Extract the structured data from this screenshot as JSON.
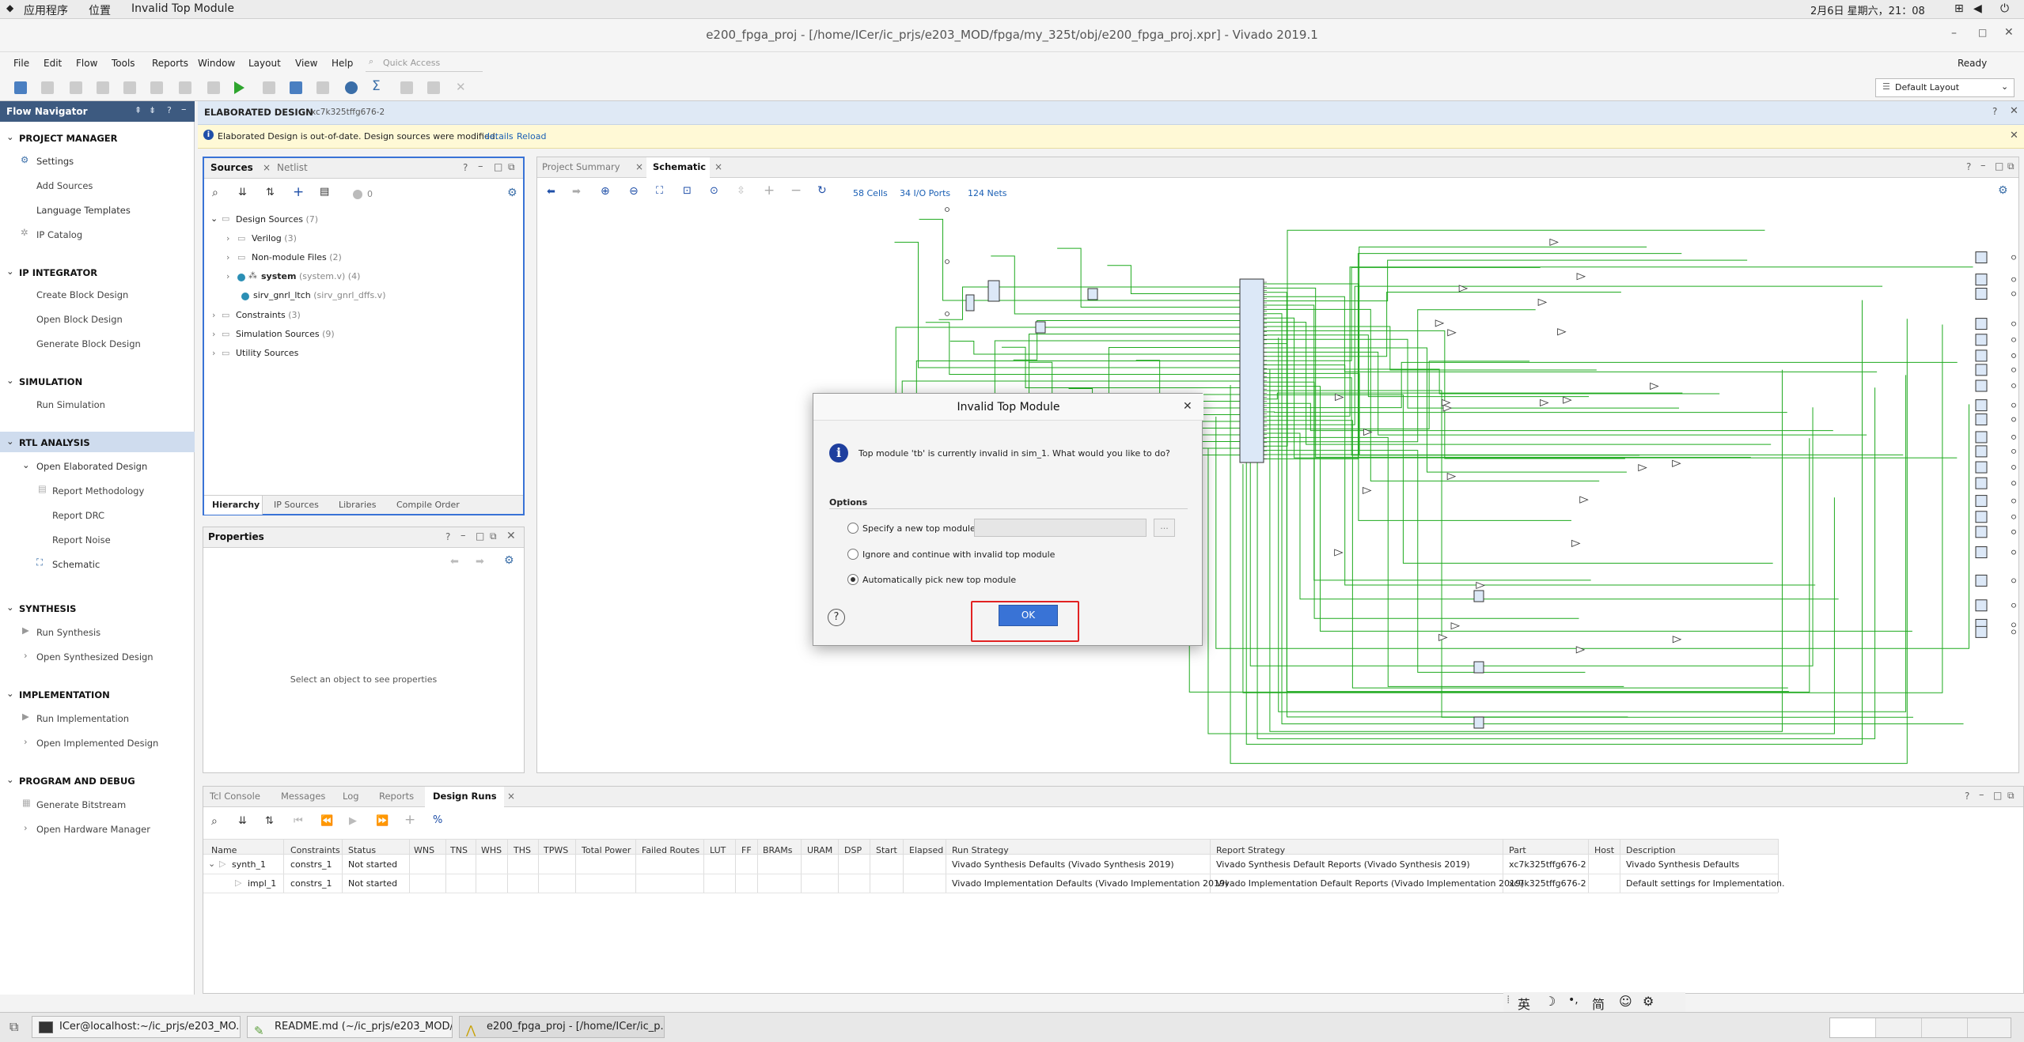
{
  "system_bar": {
    "apps": "应用程序",
    "places": "位置",
    "active_window": "Invalid Top Module",
    "clock": "2月6日 星期六，21：08"
  },
  "window": {
    "title": "e200_fpga_proj - [/home/ICer/ic_prjs/e203_MOD/fpga/my_325t/obj/e200_fpga_proj.xpr] - Vivado 2019.1",
    "status": "Ready"
  },
  "menu": [
    "File",
    "Edit",
    "Flow",
    "Tools",
    "Reports",
    "Window",
    "Layout",
    "View",
    "Help"
  ],
  "quick_access": {
    "placeholder": "Quick Access"
  },
  "layout_select": "Default Layout",
  "flow_navigator": {
    "title": "Flow Navigator",
    "sections": [
      {
        "label": "PROJECT MANAGER",
        "items": [
          "Settings",
          "Add Sources",
          "Language Templates",
          "IP Catalog"
        ]
      },
      {
        "label": "IP INTEGRATOR",
        "items": [
          "Create Block Design",
          "Open Block Design",
          "Generate Block Design"
        ]
      },
      {
        "label": "SIMULATION",
        "items": [
          "Run Simulation"
        ]
      },
      {
        "label": "RTL ANALYSIS",
        "items": [
          "Open Elaborated Design",
          "Report Methodology",
          "Report DRC",
          "Report Noise",
          "Schematic"
        ]
      },
      {
        "label": "SYNTHESIS",
        "items": [
          "Run Synthesis",
          "Open Synthesized Design"
        ]
      },
      {
        "label": "IMPLEMENTATION",
        "items": [
          "Run Implementation",
          "Open Implemented Design"
        ]
      },
      {
        "label": "PROGRAM AND DEBUG",
        "items": [
          "Generate Bitstream",
          "Open Hardware Manager"
        ]
      }
    ]
  },
  "elaborated": {
    "title": "ELABORATED DESIGN",
    "part": "xc7k325tffg676-2"
  },
  "warning": {
    "text": "Elaborated Design is out-of-date. Design sources were modified.",
    "details": "details",
    "reload": "Reload"
  },
  "sources": {
    "tabs": [
      "Sources",
      "Netlist"
    ],
    "count": "0",
    "tree": [
      {
        "label": "Design Sources",
        "extra": "(7)"
      },
      {
        "label": "Verilog",
        "extra": "(3)"
      },
      {
        "label": "Non-module Files",
        "extra": "(2)"
      },
      {
        "label": "system",
        "extra": "(system.v) (4)"
      },
      {
        "label": "sirv_gnrl_ltch",
        "extra": "(sirv_gnrl_dffs.v)"
      },
      {
        "label": "Constraints",
        "extra": "(3)"
      },
      {
        "label": "Simulation Sources",
        "extra": "(9)"
      },
      {
        "label": "Utility Sources",
        "extra": ""
      }
    ],
    "bottom_tabs": [
      "Hierarchy",
      "IP Sources",
      "Libraries",
      "Compile Order"
    ]
  },
  "properties": {
    "title": "Properties",
    "empty": "Select an object to see properties"
  },
  "schematic": {
    "tabs": [
      "Project Summary",
      "Schematic"
    ],
    "cells": "58 Cells",
    "ports": "34 I/O Ports",
    "nets": "124 Nets"
  },
  "dialog": {
    "title": "Invalid Top Module",
    "message": "Top module 'tb' is currently invalid in sim_1. What would you like to do?",
    "options_label": "Options",
    "option1": "Specify a new top module:",
    "option1_value": "",
    "option2": "Ignore and continue with invalid top module",
    "option3": "Automatically pick new top module",
    "selected": 3,
    "browse": "...",
    "ok": "OK"
  },
  "bottom_panel": {
    "tabs": [
      "Tcl Console",
      "Messages",
      "Log",
      "Reports",
      "Design Runs"
    ],
    "columns": [
      "Name",
      "Constraints",
      "Status",
      "WNS",
      "TNS",
      "WHS",
      "THS",
      "TPWS",
      "Total Power",
      "Failed Routes",
      "LUT",
      "FF",
      "BRAMs",
      "URAM",
      "DSP",
      "Start",
      "Elapsed",
      "Run Strategy",
      "Report Strategy",
      "Part",
      "Host",
      "Description"
    ],
    "rows": [
      {
        "name": "synth_1",
        "constraints": "constrs_1",
        "status": "Not started",
        "run_strategy": "Vivado Synthesis Defaults (Vivado Synthesis 2019)",
        "report_strategy": "Vivado Synthesis Default Reports (Vivado Synthesis 2019)",
        "part": "xc7k325tffg676-2",
        "description": "Vivado Synthesis Defaults"
      },
      {
        "name": "impl_1",
        "constraints": "constrs_1",
        "status": "Not started",
        "run_strategy": "Vivado Implementation Defaults (Vivado Implementation 2019)",
        "report_strategy": "Vivado Implementation Default Reports (Vivado Implementation 2019)",
        "part": "xc7k325tffg676-2",
        "description": "Default settings for Implementation."
      }
    ]
  },
  "ime": [
    "英",
    "简"
  ],
  "taskbar": [
    "ICer@localhost:~/ic_prjs/e203_MO...",
    "README.md (~/ic_prjs/e203_MOD/...",
    "e200_fpga_proj - [/home/ICer/ic_p..."
  ],
  "colors": {
    "nav_header": "#3d5a80",
    "accent": "#3973d6",
    "wire": "#1faa1f",
    "highlight": "#e22222"
  }
}
